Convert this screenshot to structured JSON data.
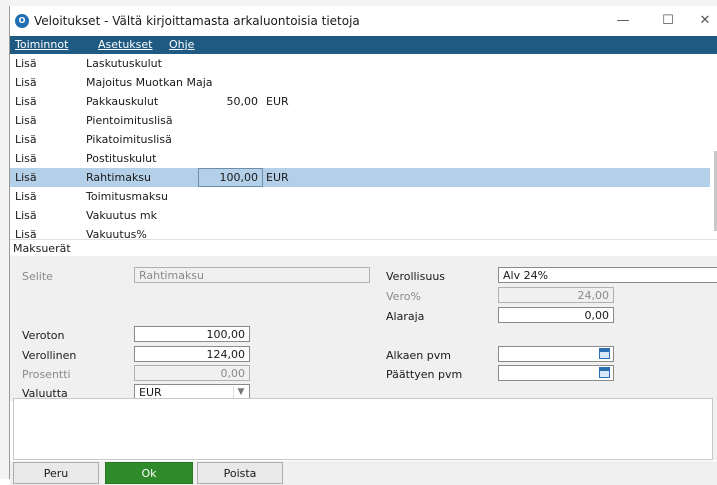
{
  "window": {
    "title": "Veloitukset - Vältä kirjoittamasta arkaluontoisia tietoja",
    "app_icon_letter": "O",
    "minimize_glyph": "—",
    "maximize_glyph": "☐",
    "close_glyph": "✕"
  },
  "menu": [
    {
      "label": "Toiminnot"
    },
    {
      "label": "Asetukset"
    },
    {
      "label": "Ohje"
    }
  ],
  "rows": [
    {
      "type": "Lisä",
      "name": "Laskutuskulut",
      "amount": "",
      "currency": ""
    },
    {
      "type": "Lisä",
      "name": "Majoitus Muotkan Maja",
      "amount": "",
      "currency": ""
    },
    {
      "type": "Lisä",
      "name": "Pakkauskulut",
      "amount": "50,00",
      "currency": "EUR"
    },
    {
      "type": "Lisä",
      "name": "Pientoimituslisä",
      "amount": "",
      "currency": ""
    },
    {
      "type": "Lisä",
      "name": "Pikatoimituslisä",
      "amount": "",
      "currency": ""
    },
    {
      "type": "Lisä",
      "name": "Postituskulut",
      "amount": "",
      "currency": ""
    },
    {
      "type": "Lisä",
      "name": "Rahtimaksu",
      "amount": "100,00",
      "currency": "EUR",
      "selected": true
    },
    {
      "type": "Lisä",
      "name": "Toimitusmaksu",
      "amount": "",
      "currency": ""
    },
    {
      "type": "Lisä",
      "name": "Vakuutus mk",
      "amount": "",
      "currency": ""
    },
    {
      "type": "Lisä",
      "name": "Vakuutus%",
      "amount": "",
      "currency": ""
    }
  ],
  "section_label": "Maksuerät",
  "form": {
    "selite_label": "Selite",
    "selite_value": "Rahtimaksu",
    "verollisuus_label": "Verollisuus",
    "verollisuus_value": "Alv 24%",
    "vero_label": "Vero%",
    "vero_value": "24,00",
    "alaraja_label": "Alaraja",
    "alaraja_value": "0,00",
    "veroton_label": "Veroton",
    "veroton_value": "100,00",
    "verollinen_label": "Verollinen",
    "verollinen_value": "124,00",
    "prosentti_label": "Prosentti",
    "prosentti_value": "0,00",
    "valuutta_label": "Valuutta",
    "valuutta_value": "EUR",
    "alkaen_label": "Alkaen pvm",
    "alkaen_value": "",
    "paattyen_label": "Päättyen pvm",
    "paattyen_value": ""
  },
  "buttons": {
    "peru": "Peru",
    "ok": "Ok",
    "poista": "Poista"
  }
}
